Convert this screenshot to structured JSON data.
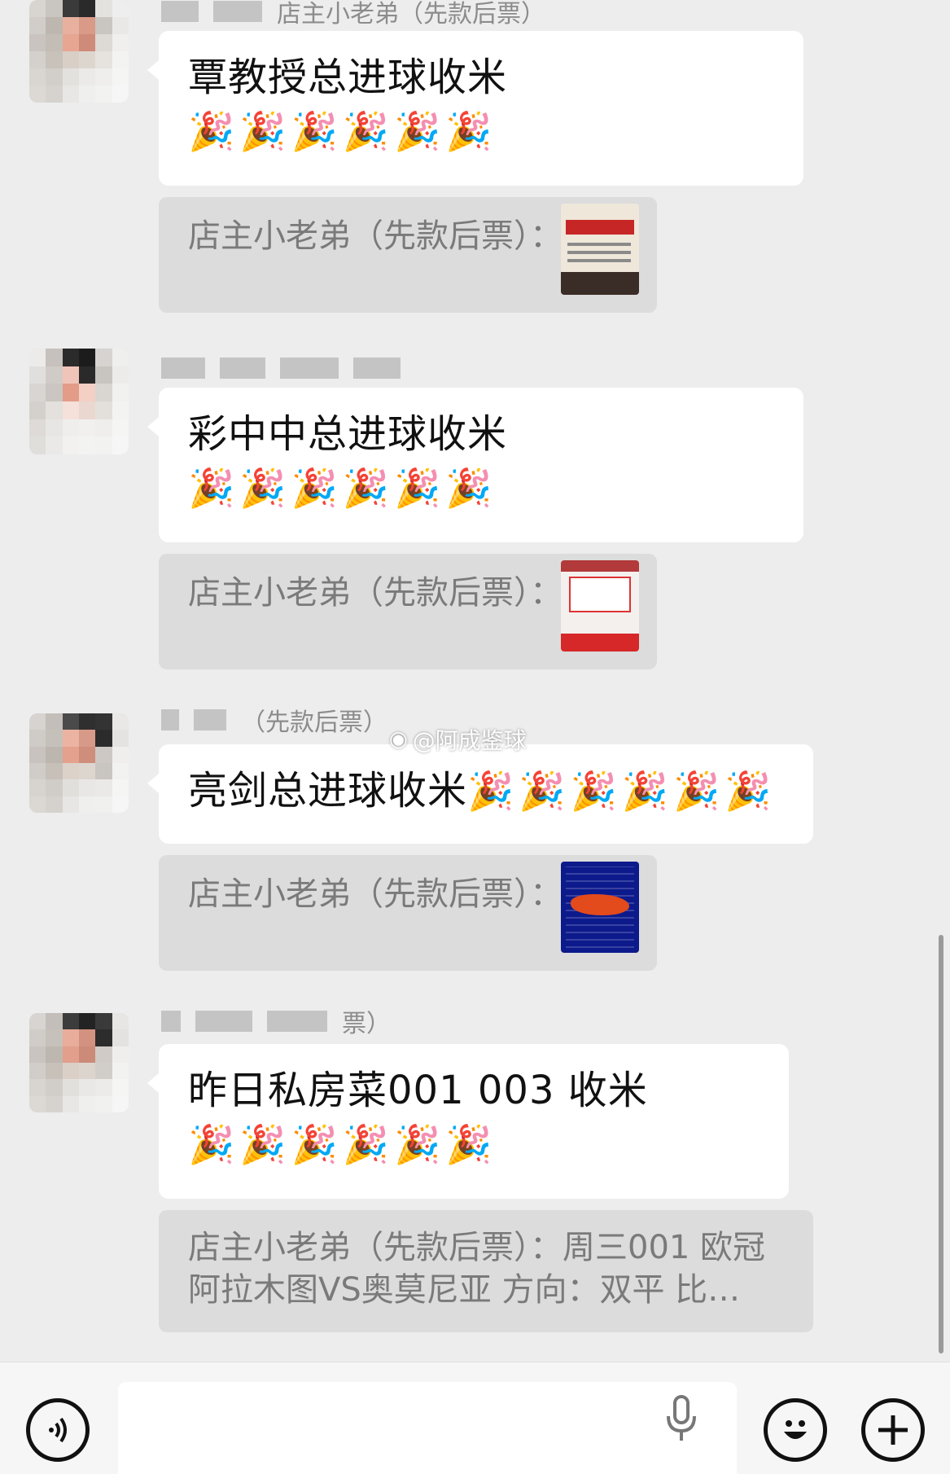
{
  "messages": [
    {
      "text": "覃教授总进球收米",
      "party": "🎉🎉🎉🎉🎉🎉",
      "quote": "店主小老弟（先款后票）：",
      "sender": "店主小老弟（先款后票）"
    },
    {
      "text": "彩中中总进球收米",
      "party": "🎉🎉🎉🎉🎉🎉",
      "quote": "店主小老弟（先款后票）："
    },
    {
      "text": "亮剑总进球收米",
      "party": "🎉🎉🎉🎉🎉🎉",
      "quote": "店主小老弟（先款后票）：",
      "sender": "（先款后票）"
    },
    {
      "text": "昨日私房菜001  003 收米",
      "party": "🎉🎉🎉🎉🎉🎉",
      "quote": "店主小老弟（先款后票）：周三001 欧冠阿拉木图VS奥莫尼亚 方向：双平 比…",
      "sender": "票）"
    }
  ],
  "watermark": "@阿成鉴球",
  "icons": {
    "voice": "voice-icon",
    "mic": "mic-icon",
    "emoji": "emoji-icon",
    "plus": "plus-icon"
  }
}
